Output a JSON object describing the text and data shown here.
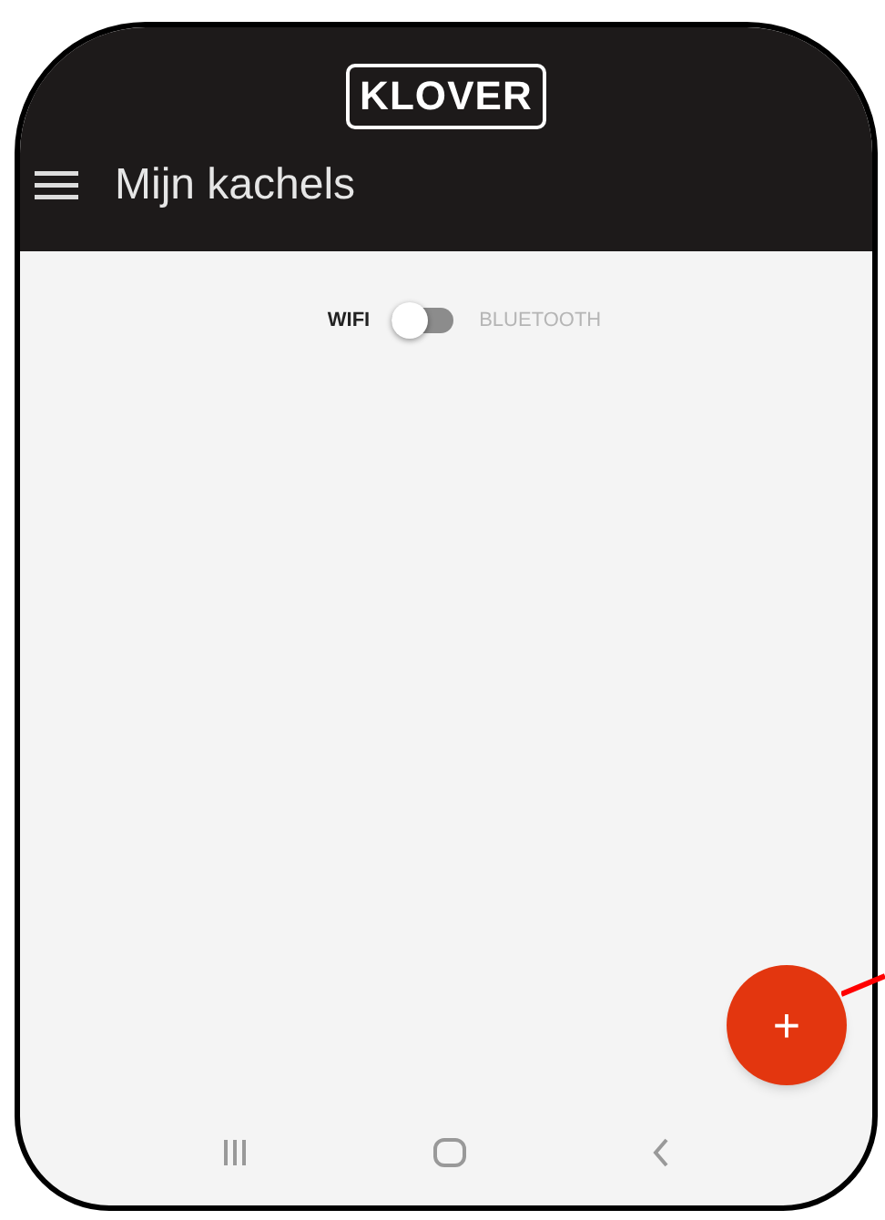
{
  "header": {
    "logo": "KLOVER",
    "title": "Mijn kachels"
  },
  "connection": {
    "options": [
      {
        "label": "WIFI",
        "selected": true
      },
      {
        "label": "BLUETOOTH",
        "selected": false
      }
    ],
    "on": false
  },
  "fab": {
    "label": "+"
  }
}
